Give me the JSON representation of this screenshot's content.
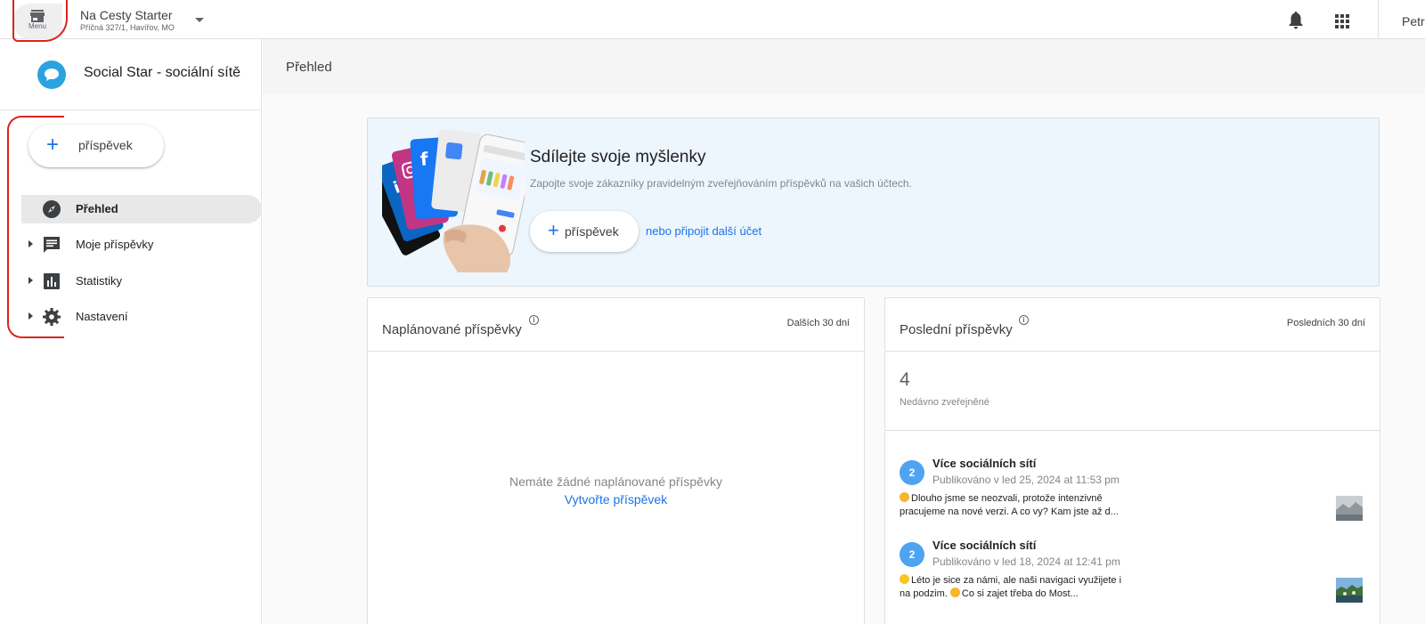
{
  "topbar": {
    "menu_label": "Menu",
    "business_name": "Na Cesty Starter",
    "business_address": "Příčná 327/1, Havířov, MO",
    "user_name": "Petr"
  },
  "sidebar": {
    "app_name": "Social Star - sociální sítě",
    "new_post_label": "příspěvek",
    "items": [
      {
        "label": "Přehled"
      },
      {
        "label": "Moje příspěvky"
      },
      {
        "label": "Statistiky"
      },
      {
        "label": "Nastavení"
      }
    ]
  },
  "main": {
    "title": "Přehled",
    "hero": {
      "title": "Sdílejte svoje myšlenky",
      "subtitle": "Zapojte svoje zákazníky pravidelným zveřejňováním příspěvků na vašich účtech.",
      "button_label": "příspěvek",
      "link_label": "nebo připojit další účet"
    },
    "scheduled": {
      "title": "Naplánované příspěvky",
      "range": "Dalších 30 dní",
      "empty_message": "Nemáte žádné naplánované příspěvky",
      "empty_link": "Vytvořte příspěvek"
    },
    "recent": {
      "title": "Poslední příspěvky",
      "range": "Posledních 30 dní",
      "count": "4",
      "count_label": "Nedávno zveřejněné",
      "posts": [
        {
          "badge": "2",
          "name": "Více sociálních sítí",
          "date": "Publikováno v led 25, 2024 at 11:53 pm",
          "text_line1": "Dlouho jsme se neozvali, protože intenzivně",
          "text_line2": "pracujeme na nové verzi. A co vy? Kam jste až d..."
        },
        {
          "badge": "2",
          "name": "Více sociálních sítí",
          "date": "Publikováno v led 18, 2024 at 12:41 pm",
          "text_line1": "Léto je sice za námi, ale naši navigaci využijete i",
          "text_line2_a": "na podzim.",
          "text_line2_b": "Co si zajet třeba do Most..."
        }
      ]
    }
  },
  "colors": {
    "accent": "#1a73e8",
    "logo": "#2aa3e0",
    "annotation": "#d9251c",
    "hero_bg": "#eef6fd"
  }
}
